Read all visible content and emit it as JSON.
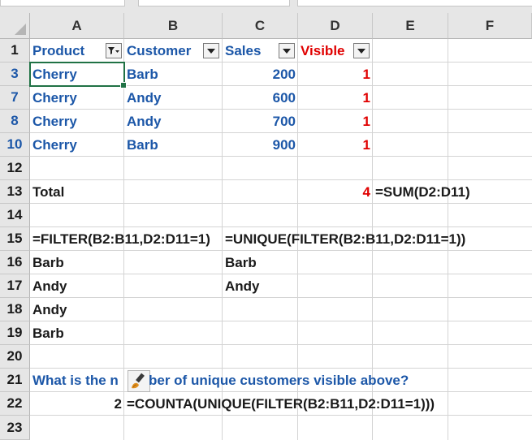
{
  "columns": [
    "A",
    "B",
    "C",
    "D",
    "E",
    "F"
  ],
  "rows": [
    "1",
    "3",
    "7",
    "8",
    "10",
    "12",
    "13",
    "14",
    "15",
    "16",
    "17",
    "18",
    "19",
    "20",
    "21",
    "22",
    "23"
  ],
  "headers": {
    "product": "Product",
    "customer": "Customer",
    "sales": "Sales",
    "visible": "Visible"
  },
  "data_rows": [
    {
      "product": "Cherry",
      "customer": "Barb",
      "sales": "200",
      "visible": "1"
    },
    {
      "product": "Cherry",
      "customer": "Andy",
      "sales": "600",
      "visible": "1"
    },
    {
      "product": "Cherry",
      "customer": "Andy",
      "sales": "700",
      "visible": "1"
    },
    {
      "product": "Cherry",
      "customer": "Barb",
      "sales": "900",
      "visible": "1"
    }
  ],
  "total": {
    "label": "Total",
    "value": "4",
    "formula": "=SUM(D2:D11)"
  },
  "filter_formula": "=FILTER(B2:B11,D2:D11=1)",
  "unique_formula": "=UNIQUE(FILTER(B2:B11,D2:D11=1))",
  "filter_results": [
    "Barb",
    "Andy",
    "Andy",
    "Barb"
  ],
  "unique_results": [
    "Barb",
    "Andy"
  ],
  "question_start": "What is the n",
  "question_end": "ber of unique customers visible above?",
  "answer": {
    "value": "2",
    "formula": "=COUNTA(UNIQUE(FILTER(B2:B11,D2:D11=1)))"
  },
  "icons": {
    "filter_active": "filter-funnel-icon",
    "dropdown": "dropdown-arrow-icon",
    "format_painter": "paintbrush-icon"
  },
  "colors": {
    "header_blue": "#1c57a8",
    "visible_red": "#e00000",
    "grid": "#d4d4d4",
    "header_bg": "#e6e6e6",
    "selection": "#207245"
  }
}
